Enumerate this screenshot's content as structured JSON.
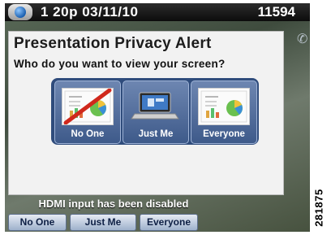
{
  "status": {
    "datetime": "1 20p 03/11/10",
    "extension": "11594"
  },
  "dialog": {
    "title": "Presentation Privacy Alert",
    "question": "Who do you want to view your screen?",
    "options": [
      {
        "label": "No One",
        "icon": "chart-screen-crossed-icon"
      },
      {
        "label": "Just Me",
        "icon": "laptop-icon"
      },
      {
        "label": "Everyone",
        "icon": "chart-screen-icon"
      }
    ]
  },
  "notice": "HDMI input has been disabled",
  "softkeys": [
    "No One",
    "Just Me",
    "Everyone"
  ],
  "figure_id": "281875",
  "colors": {
    "accent": "#2f4c7c",
    "statusbar": "#111111",
    "softkey": "#c4d0e2"
  }
}
